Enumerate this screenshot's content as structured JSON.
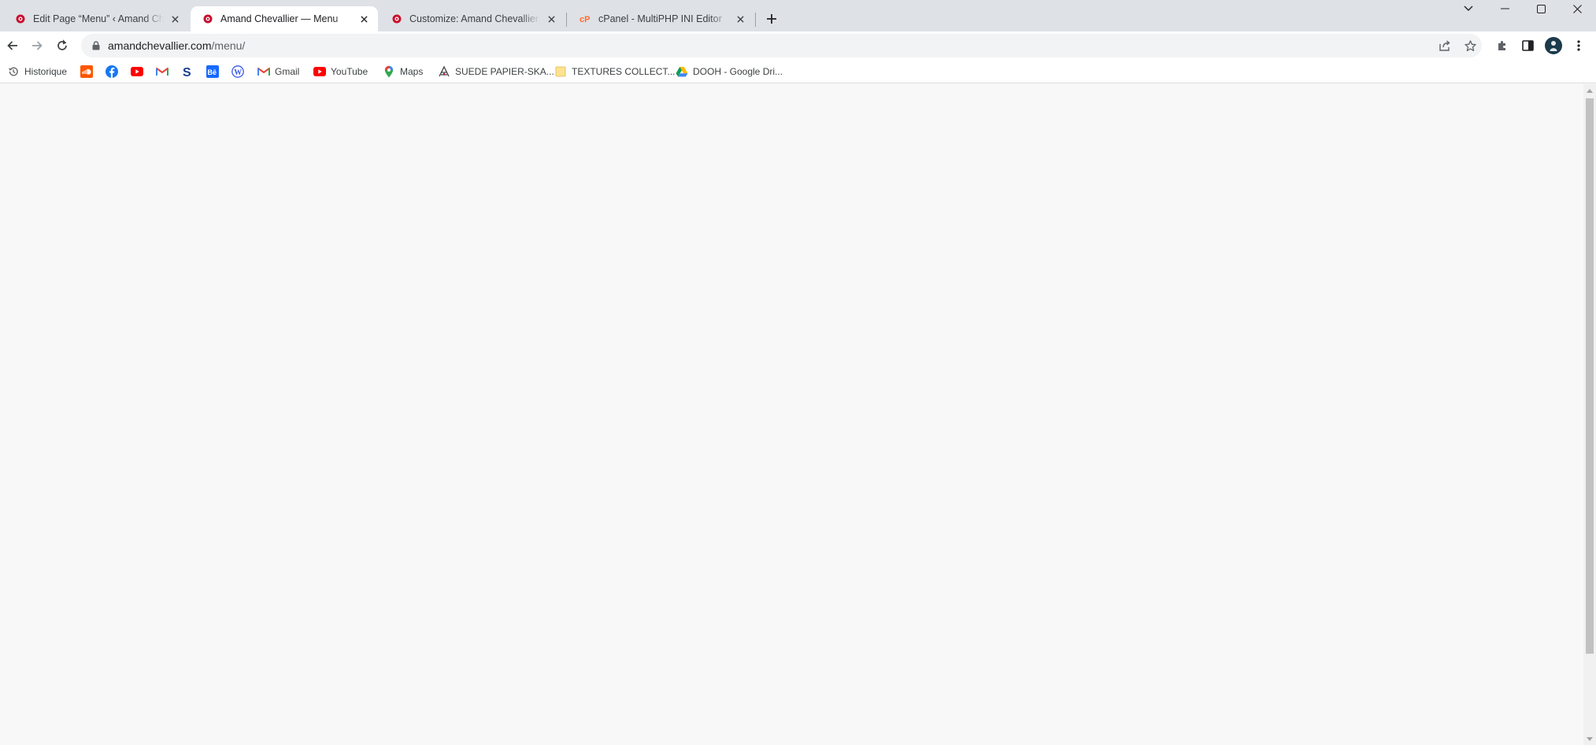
{
  "browser": {
    "tabs": [
      {
        "title": "Edit Page “Menu” ‹ Amand Chevallier — WordPress",
        "favicon": "site-favicon-icon",
        "active": false
      },
      {
        "title": "Amand Chevallier — Menu",
        "favicon": "site-favicon-icon",
        "active": true
      },
      {
        "title": "Customize: Amand Chevallier — Menu",
        "favicon": "site-favicon-icon",
        "active": false
      },
      {
        "title": "cPanel - MultiPHP INI Editor",
        "favicon": "cpanel-icon",
        "active": false
      }
    ],
    "address": {
      "domain": "amandchevallier.com",
      "path": "/menu/"
    },
    "bookmarks": [
      {
        "label": "Historique",
        "icon": "history-icon"
      },
      {
        "label": "",
        "icon": "soundcloud-icon"
      },
      {
        "label": "",
        "icon": "facebook-icon"
      },
      {
        "label": "",
        "icon": "youtube-icon"
      },
      {
        "label": "",
        "icon": "gmail-icon"
      },
      {
        "label": "",
        "icon": "s-logo-icon"
      },
      {
        "label": "",
        "icon": "behance-icon"
      },
      {
        "label": "",
        "icon": "wordpress-icon"
      },
      {
        "label": "Gmail",
        "icon": "gmail-icon"
      },
      {
        "label": "YouTube",
        "icon": "youtube-icon"
      },
      {
        "label": "Maps",
        "icon": "maps-pin-icon"
      },
      {
        "label": "SUEDE PAPIER-SKA...",
        "icon": "suede-logo-icon"
      },
      {
        "label": "TEXTURES COLLECT...",
        "icon": "folder-icon"
      },
      {
        "label": "DOOH - Google Dri...",
        "icon": "google-drive-icon"
      }
    ]
  },
  "colors": {
    "tabstrip": "#dee1e6",
    "toolbar": "#ffffff",
    "omnibox": "#f1f3f4",
    "page_background": "#f8f8f8",
    "scroll_thumb": "#c1c1c1"
  }
}
